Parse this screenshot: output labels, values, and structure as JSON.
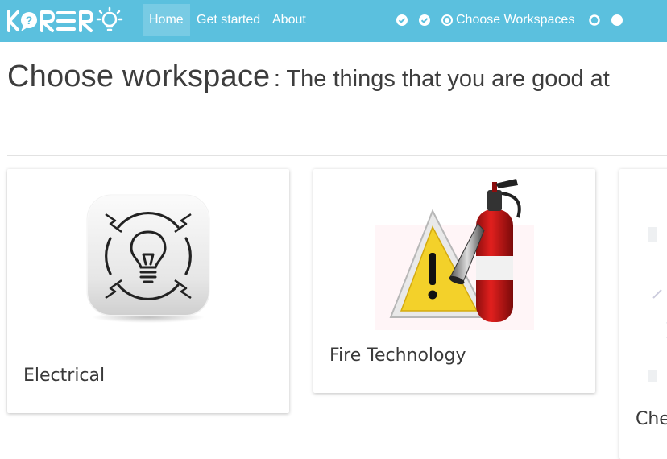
{
  "nav": {
    "logo_text": "KORERO",
    "links": [
      {
        "label": "Home",
        "active": true
      },
      {
        "label": "Get started",
        "active": false
      },
      {
        "label": "About",
        "active": false
      }
    ],
    "steps": [
      {
        "state": "done",
        "icon": "check-circle-icon"
      },
      {
        "state": "done",
        "icon": "check-circle-icon"
      },
      {
        "state": "current",
        "icon": "radio-dot-icon",
        "label": "Choose Workspaces"
      },
      {
        "state": "todo",
        "icon": "circle-outline-icon"
      },
      {
        "state": "todo",
        "icon": "circle-filled-icon"
      }
    ],
    "colors": {
      "bar": "#5bc0de",
      "text": "#ffffff"
    }
  },
  "page": {
    "title": "Choose workspace",
    "subtitle": ": The things that you are good at"
  },
  "workspaces": [
    {
      "name": "Electrical",
      "icon": "lightbulb-icon"
    },
    {
      "name": "Fire Technology",
      "icon": "fire-extinguisher-icon"
    },
    {
      "name": "Che",
      "icon": "chemistry-icon"
    }
  ]
}
